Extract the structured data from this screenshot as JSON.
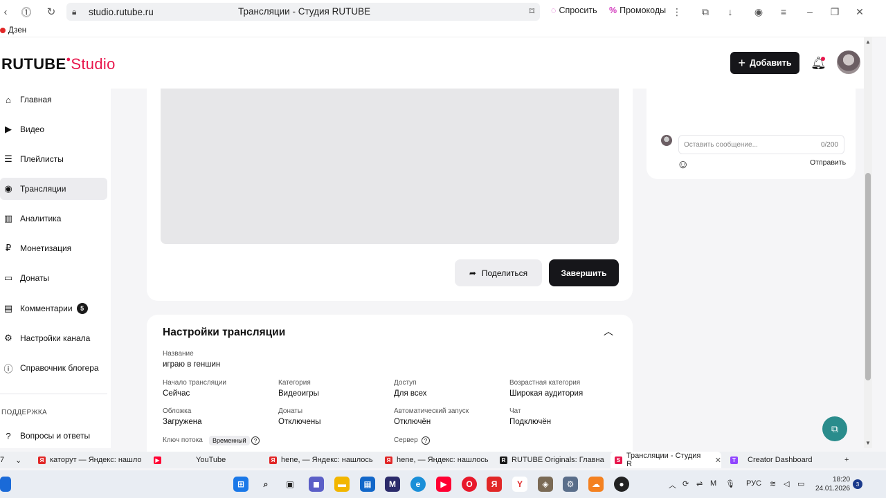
{
  "browser": {
    "url": "studio.rutube.ru",
    "page_title": "Трансляции - Студия RUTUBE",
    "sprosit_label": "Спросить",
    "promo_label": "Промокоды"
  },
  "bookmarks": {
    "dzen_label": "Дзен"
  },
  "header": {
    "logo_main": "RUTUBE",
    "logo_studio": "Studio",
    "add_label": "Добавить"
  },
  "sidebar": {
    "items": [
      {
        "label": "Главная",
        "icon": "home-icon"
      },
      {
        "label": "Видео",
        "icon": "video-icon"
      },
      {
        "label": "Плейлисты",
        "icon": "playlist-icon"
      },
      {
        "label": "Трансляции",
        "icon": "broadcast-icon"
      },
      {
        "label": "Аналитика",
        "icon": "analytics-icon"
      },
      {
        "label": "Монетизация",
        "icon": "ruble-icon"
      },
      {
        "label": "Донаты",
        "icon": "wallet-icon"
      },
      {
        "label": "Комментарии",
        "icon": "comment-icon",
        "badge": "5"
      },
      {
        "label": "Настройки канала",
        "icon": "gear-icon"
      },
      {
        "label": "Справочник блогера",
        "icon": "info-icon"
      }
    ],
    "support_section": "ПОДДЕРЖКА",
    "faq_label": "Вопросы и ответы"
  },
  "player": {
    "share_label": "Поделиться",
    "finish_label": "Завершить"
  },
  "settings": {
    "title": "Настройки трансляции",
    "name_label": "Название",
    "name_value": "играю в геншин",
    "start_label": "Начало трансляции",
    "start_value": "Сейчас",
    "category_label": "Категория",
    "category_value": "Видеоигры",
    "access_label": "Доступ",
    "access_value": "Для всех",
    "age_label": "Возрастная категория",
    "age_value": "Широкая аудитория",
    "cover_label": "Обложка",
    "cover_value": "Загружена",
    "donations_label": "Донаты",
    "donations_value": "Отключены",
    "autostart_label": "Автоматический запуск",
    "autostart_value": "Отключён",
    "chat_label": "Чат",
    "chat_value": "Подключён",
    "stream_key_label": "Ключ потока",
    "stream_key_badge": "Временный",
    "server_label": "Сервер"
  },
  "chat": {
    "placeholder": "Оставить сообщение...",
    "counter": "0/200",
    "send_label": "Отправить"
  },
  "tabs": [
    {
      "label": "7"
    },
    {
      "label": "катоpут — Яндекс: нашло",
      "fav_color": "#e12727",
      "fav": "Я"
    },
    {
      "label": "YouTube",
      "fav_color": "#ff0033",
      "fav": "▶"
    },
    {
      "label": "hene, — Яндекс: нашлось",
      "fav_color": "#e12727",
      "fav": "Я"
    },
    {
      "label": "hene, — Яндекс: нашлось",
      "fav_color": "#e12727",
      "fav": "Я"
    },
    {
      "label": "RUTUBE Originals: Главна",
      "fav_color": "#1a1a1a",
      "fav": "R"
    },
    {
      "label": "Трансляции - Студия R",
      "fav_color": "#e8174c",
      "fav": "S",
      "active": true
    },
    {
      "label": "Creator Dashboard",
      "fav_color": "#9146ff",
      "fav": "T"
    }
  ],
  "taskbar": {
    "lang": "РУС",
    "time": "18:20",
    "date": "24.01.2026",
    "notifications": "3"
  },
  "colors": {
    "accent": "#e8174c",
    "dark_button": "#16161a",
    "fab": "#2a8c8c"
  }
}
